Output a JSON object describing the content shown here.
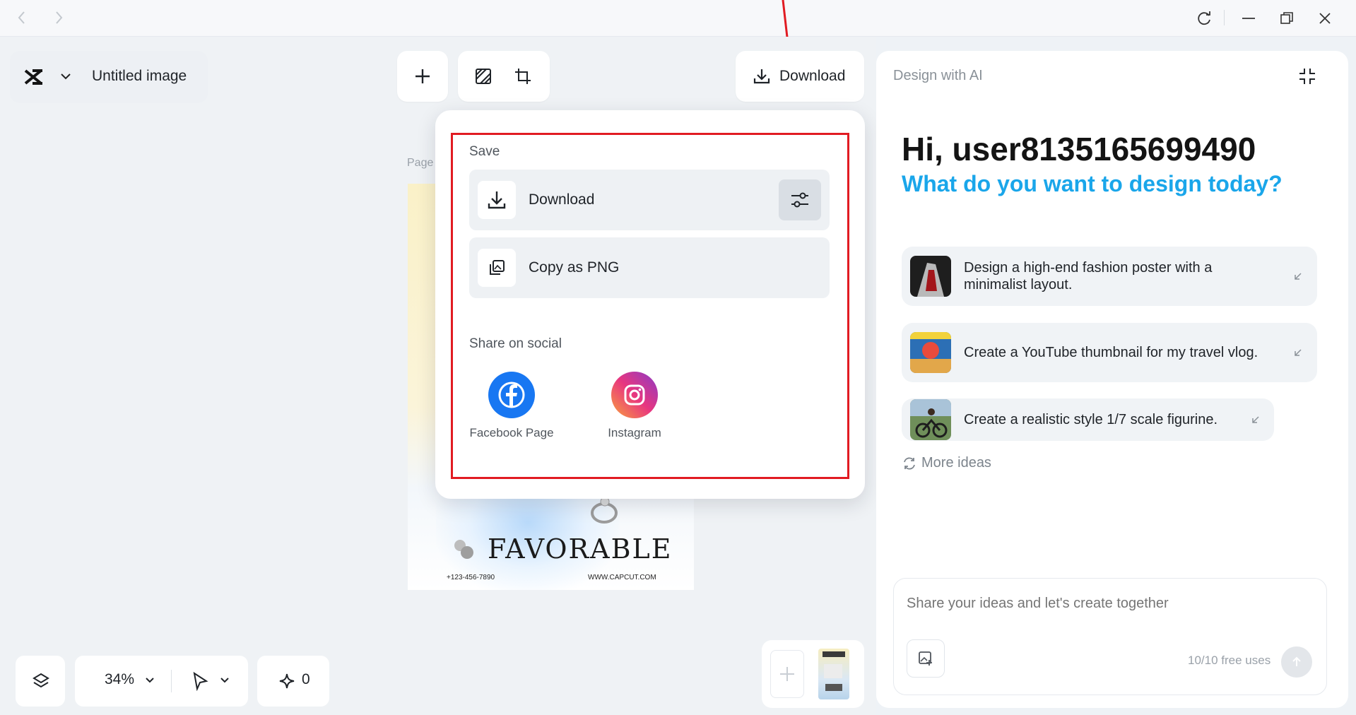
{
  "app": {
    "title": "Untitled image"
  },
  "toolbar": {
    "download_label": "Download"
  },
  "page": {
    "label": "Page",
    "brand_text": "FAVORABLE",
    "phone_text": "+123-456-7890",
    "site_text": "WWW.CAPCUT.COM"
  },
  "download_menu": {
    "save_heading": "Save",
    "download_label": "Download",
    "copy_label": "Copy as PNG",
    "share_heading": "Share on social",
    "social": [
      {
        "name": "Facebook Page",
        "icon": "facebook-icon",
        "color": "#1877f2"
      },
      {
        "name": "Instagram",
        "icon": "instagram-icon"
      }
    ]
  },
  "bottom": {
    "zoom": "34%",
    "credits": "0"
  },
  "ai_panel": {
    "heading": "Design with AI",
    "greeting": "Hi, user8135165699490",
    "question": "What do you want to design today?",
    "ideas": [
      {
        "text": "Design a high-end fashion poster with a minimalist layout."
      },
      {
        "text": "Create a YouTube thumbnail for my travel vlog."
      },
      {
        "text": "Create a realistic style 1/7 scale figurine."
      }
    ],
    "more_ideas": "More ideas",
    "input_placeholder": "Share your ideas and let's create together",
    "free_uses": "10/10 free uses"
  },
  "colors": {
    "accent_blue": "#1aa6ea",
    "highlight_red": "#e11b22"
  }
}
